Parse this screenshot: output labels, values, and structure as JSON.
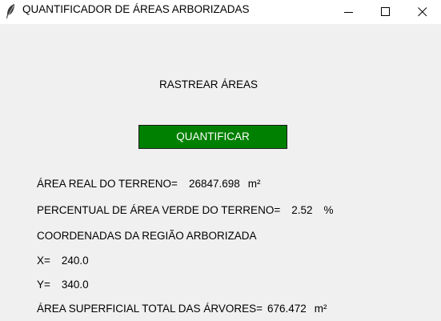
{
  "window": {
    "title": "QUANTIFICADOR DE ÁREAS ARBORIZADAS",
    "app_icon": "feather-icon",
    "controls": [
      "minimize-icon",
      "maximize-icon",
      "close-icon"
    ]
  },
  "main": {
    "heading": "RASTREAR ÁREAS",
    "quantify_button": "QUANTIFICAR",
    "button_color": "#008000",
    "results": {
      "area_label": "ÁREA REAL DO TERRENO=",
      "area_value": "26847.698",
      "area_unit": "m²",
      "green_label": "PERCENTUAL DE ÁREA VERDE DO TERRENO=",
      "green_value": "2.52",
      "green_unit": "%",
      "coords_label": "COORDENADAS DA REGIÃO ARBORIZADA",
      "x_label": "X=",
      "x_value": "240.0",
      "y_label": "Y=",
      "y_value": "340.0",
      "trees_label": "ÁREA SUPERFICIAL TOTAL DAS ÁRVORES=",
      "trees_value": "676.472",
      "trees_unit": "m²"
    }
  }
}
